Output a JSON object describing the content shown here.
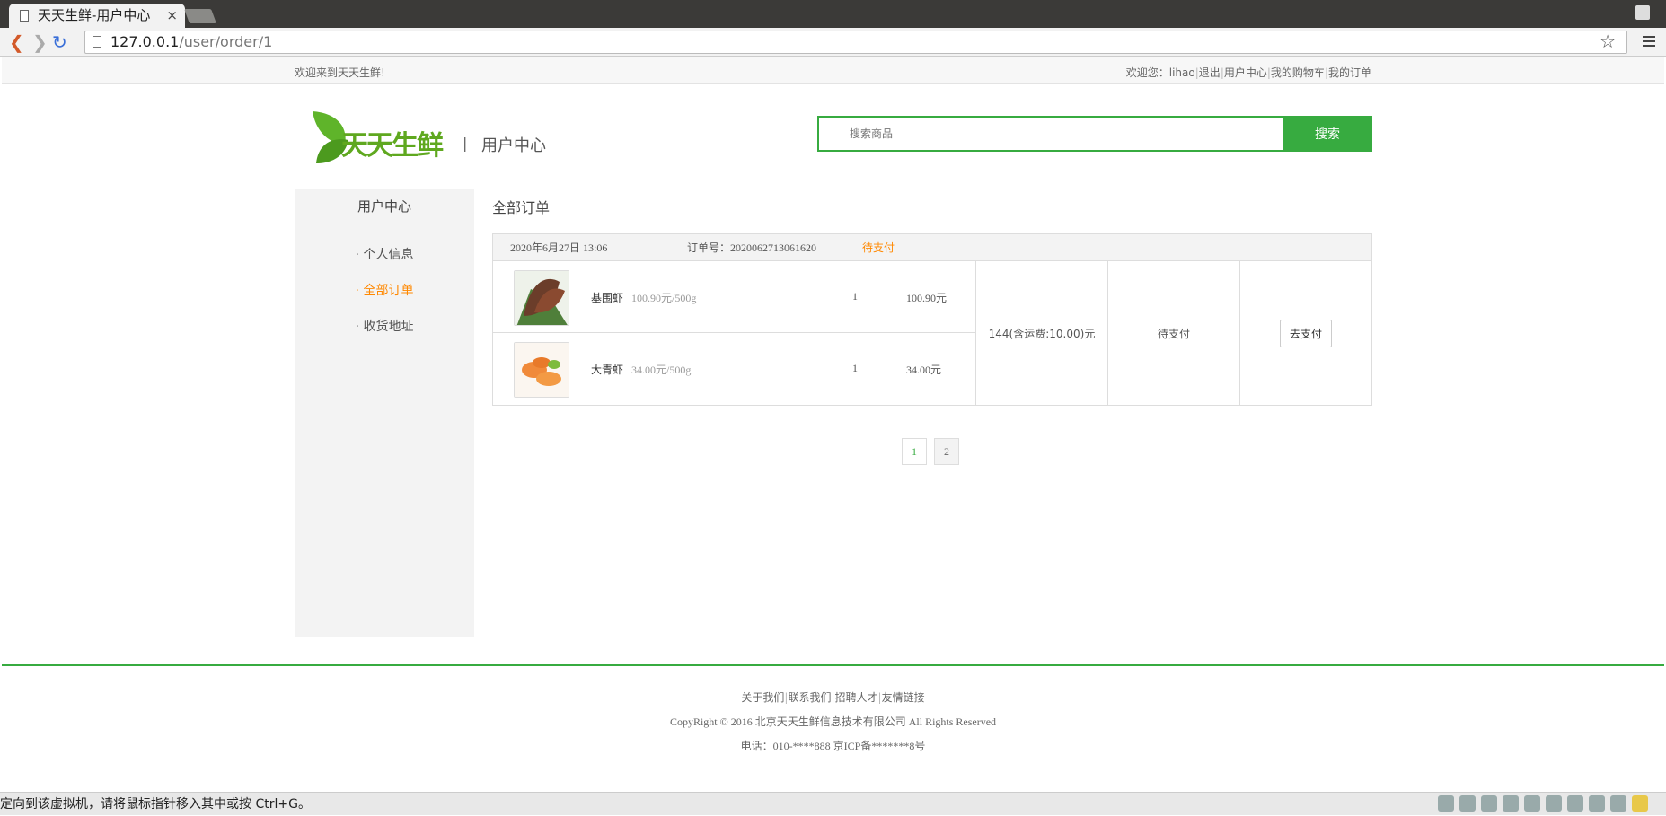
{
  "browser": {
    "tab_title": "天天生鲜-用户中心",
    "url_host": "127.0.0.1",
    "url_path": "/user/order/1"
  },
  "topbar": {
    "welcome": "欢迎来到天天生鲜!",
    "user_label": "欢迎您：lihao",
    "logout": "退出",
    "user_center": "用户中心",
    "cart": "我的购物车",
    "orders": "我的订单"
  },
  "header": {
    "logo_text": "天天生鲜",
    "subtitle": "用户中心",
    "search_placeholder": "搜索商品",
    "search_button": "搜索"
  },
  "sidebar": {
    "title": "用户中心",
    "items": [
      {
        "label": "· 个人信息"
      },
      {
        "label": "· 全部订单",
        "active": true
      },
      {
        "label": "· 收货地址"
      }
    ]
  },
  "main": {
    "title": "全部订单"
  },
  "order": {
    "time": "2020年6月27日 13:06",
    "number": "订单号：2020062713061620",
    "status": "待支付",
    "items": [
      {
        "name": "基围虾",
        "price": "100.90元/500g",
        "qty": "1",
        "subtotal": "100.90元"
      },
      {
        "name": "大青虾",
        "price": "34.00元/500g",
        "qty": "1",
        "subtotal": "34.00元"
      }
    ],
    "total": "144(含运费:10.00)元",
    "status_cell": "待支付",
    "pay_button": "去支付"
  },
  "pagination": {
    "pages": [
      "1",
      "2"
    ],
    "current": "1"
  },
  "footer": {
    "links": [
      "关于我们",
      "联系我们",
      "招聘人才",
      "友情链接"
    ],
    "copyright": "CopyRight © 2016 北京天天生鲜信息技术有限公司 All Rights Reserved",
    "contact": "电话：010-****888 京ICP备*******8号"
  },
  "statusbar": {
    "text": "定向到该虚拟机，请将鼠标指针移入其中或按 Ctrl+G。"
  },
  "colors": {
    "brand": "#37ab40",
    "accent": "#ff8800"
  }
}
